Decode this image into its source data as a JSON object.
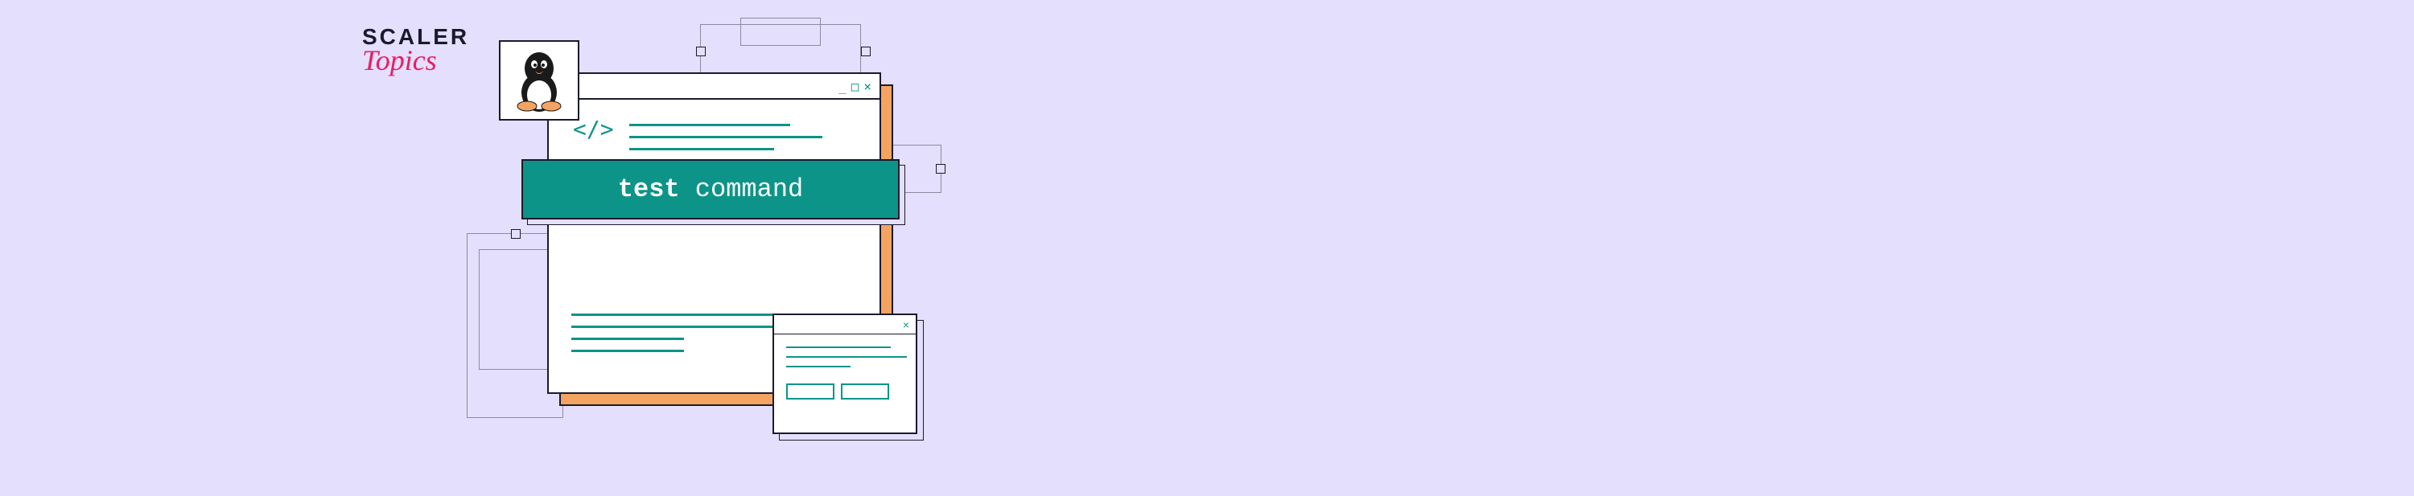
{
  "logo": {
    "line1": "SCALER",
    "line2": "Topics"
  },
  "command": {
    "keyword": "test",
    "arg": "command"
  },
  "code_tag": "</>",
  "window_controls": {
    "minimize": "_",
    "maximize": "□",
    "close": "×"
  },
  "small_close": "×",
  "colors": {
    "bg": "#E3DFFC",
    "accent": "#0d9488",
    "shadow": "#F4A460",
    "ink": "#1a1a2e",
    "pink": "#E91E63"
  },
  "icons": {
    "tux": "linux-penguin"
  }
}
